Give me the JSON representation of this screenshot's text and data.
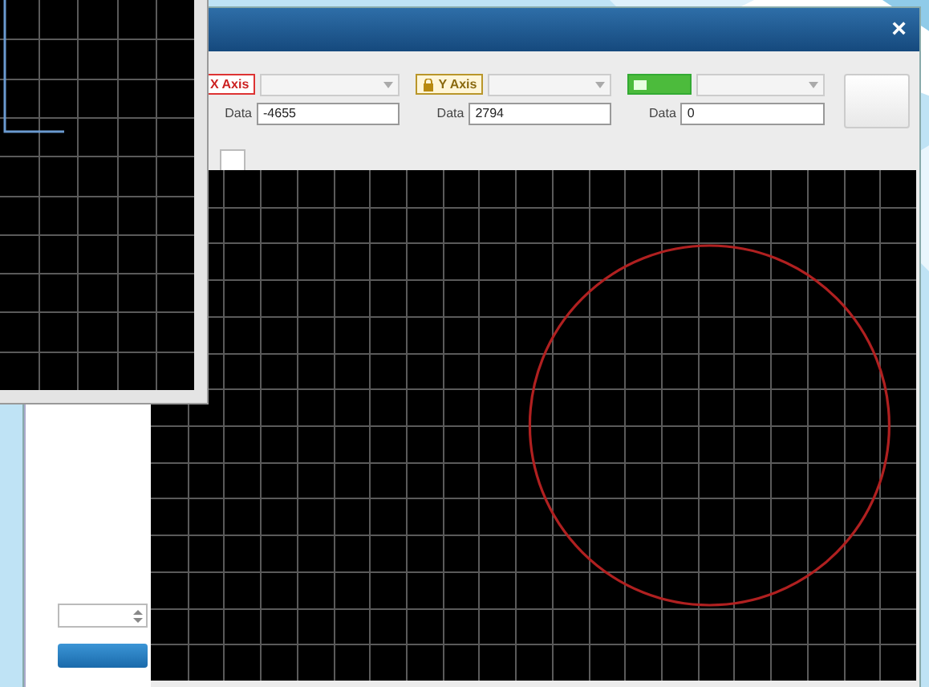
{
  "main_window": {
    "close": "×",
    "axes": [
      {
        "kind": "x",
        "label": "X Axis",
        "data_label": "Data",
        "value": "-4655"
      },
      {
        "kind": "y",
        "label": "Y Axis",
        "data_label": "Data",
        "value": "2794"
      },
      {
        "kind": "z",
        "data_label": "Data",
        "value": "0"
      }
    ]
  }
}
